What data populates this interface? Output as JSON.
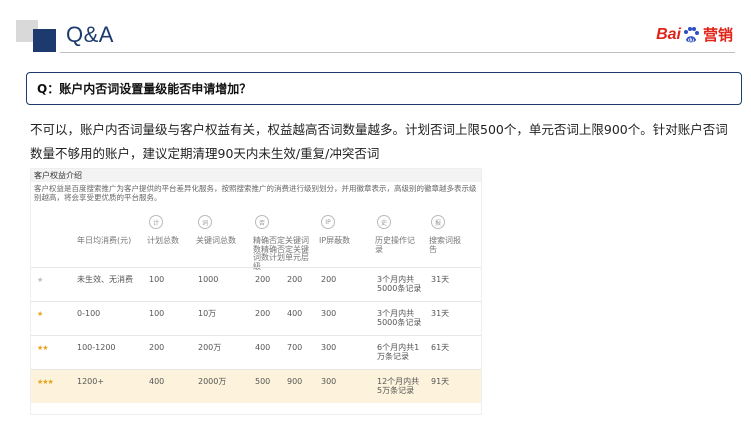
{
  "header": {
    "title": "Q&A"
  },
  "brand": {
    "bai": "Bai",
    "du": "du",
    "cn": "营销"
  },
  "question": {
    "text": "Q：账户内否词设置量级能否申请增加？"
  },
  "answer": {
    "text": "不可以，账户内否词量级与客户权益有关，权益越高否词数量越多。计划否词上限500个，单元否词上限900个。针对账户否词数量不够用的账户，建议定期清理90天内未生效/重复/冲突否词"
  },
  "screenshot": {
    "title": "客户权益介绍",
    "description": "客户权益是百度搜索推广为客户提供的平台差异化服务，按照搜索推广的消费进行级别划分，并用徽章表示，高级别的徽章越多表示级别越高，将会享受更优质的平台服务。",
    "columns": [
      {
        "icon": "计",
        "label": "年日均消费(元)"
      },
      {
        "icon": "计",
        "label": "计划总数"
      },
      {
        "icon": "词",
        "label": "关键词总数"
      },
      {
        "icon": "否",
        "label": "精确否定关键词数精确否定关键词数计划单元层级"
      },
      {
        "icon": "IP",
        "label": "IP屏蔽数"
      },
      {
        "icon": "史",
        "label": "历史操作记录"
      },
      {
        "icon": "报",
        "label": "搜索词报告"
      }
    ],
    "rows": [
      {
        "stars": 1,
        "gold": false,
        "spend": "未生效、无消费",
        "plans": "100",
        "keywords": "1000",
        "neg_plan": "200",
        "neg_unit": "200",
        "ip": "200",
        "history": "3个月内共5000条记录",
        "report": "31天"
      },
      {
        "stars": 1,
        "gold": true,
        "spend": "0-100",
        "plans": "100",
        "keywords": "10万",
        "neg_plan": "200",
        "neg_unit": "400",
        "ip": "300",
        "history": "3个月内共5000条记录",
        "report": "31天"
      },
      {
        "stars": 2,
        "gold": true,
        "spend": "100-1200",
        "plans": "200",
        "keywords": "200万",
        "neg_plan": "400",
        "neg_unit": "700",
        "ip": "300",
        "history": "6个月内共1万条记录",
        "report": "61天"
      },
      {
        "stars": 3,
        "gold": true,
        "spend": "1200+",
        "plans": "400",
        "keywords": "2000万",
        "neg_plan": "500",
        "neg_unit": "900",
        "ip": "300",
        "history": "12个月内共5万条记录",
        "report": "91天"
      }
    ]
  },
  "colors": {
    "accent": "#1d3a6e",
    "brand_red": "#e1251b",
    "brand_blue": "#2b4fc1",
    "highlight_row": "#fdf3dc",
    "star_gold": "#e8a317"
  }
}
